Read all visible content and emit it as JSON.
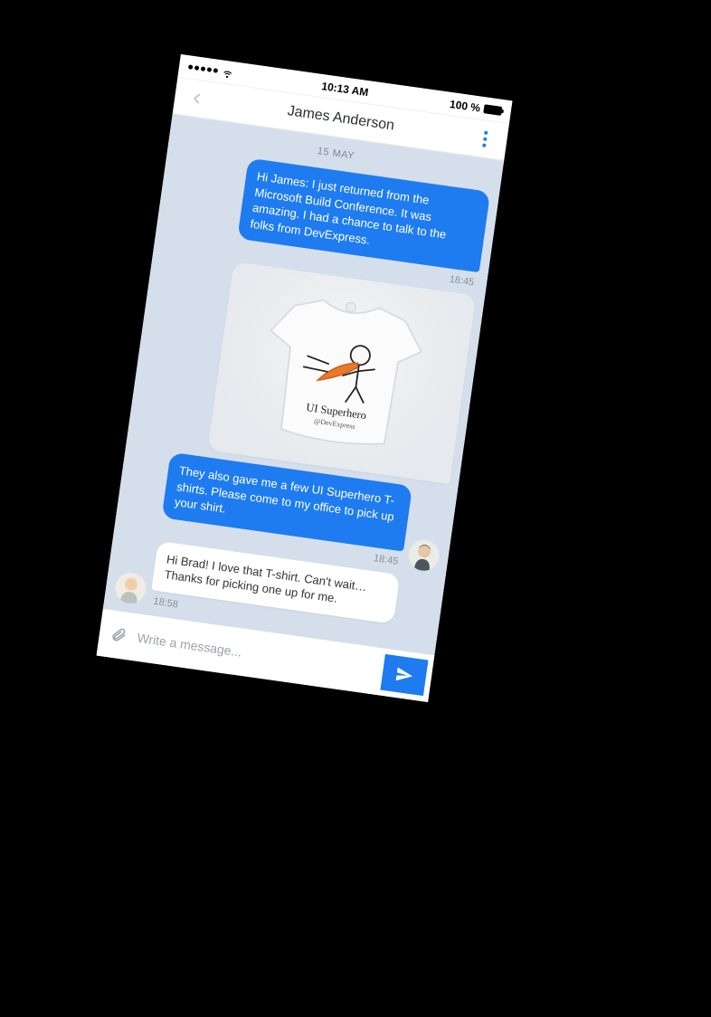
{
  "statusbar": {
    "time": "10:13 AM",
    "battery_text": "100 %"
  },
  "header": {
    "title": "James Anderson"
  },
  "chat": {
    "date_separator": "15 MAY",
    "messages": [
      {
        "side": "sent",
        "text": "Hi James: I just returned from the Microsoft Build Conference. It was amazing. I had a chance to talk to the folks from DevExpress.",
        "time": "18:45"
      },
      {
        "side": "sent",
        "type": "image",
        "image_desc": "tshirt-ui-superhero",
        "image_caption_line1": "UI Superhero",
        "image_caption_line2": "@DevExpress"
      },
      {
        "side": "sent",
        "text": "They also gave me a few UI Superhero T-shirts. Please come to my office to pick up your shirt.",
        "time": "18:45",
        "avatar": "brad"
      },
      {
        "side": "recv",
        "text": "Hi Brad! I love that T-shirt. Can't wait… Thanks for picking one up for me.",
        "time": "18:58",
        "avatar": "james"
      }
    ]
  },
  "composer": {
    "placeholder": "Write a message...",
    "value": ""
  },
  "colors": {
    "accent": "#1e7cf0",
    "chat_bg": "#d5dfeb"
  }
}
